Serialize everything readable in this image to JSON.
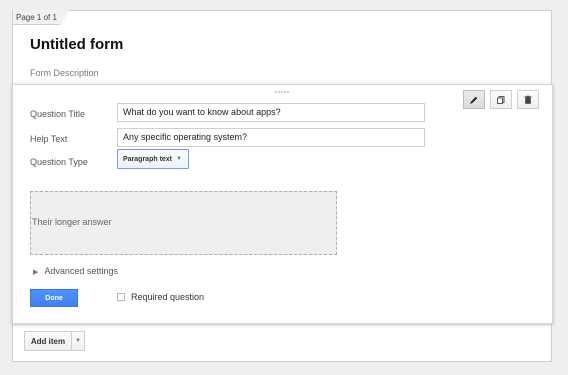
{
  "page_indicator": "Page 1 of 1",
  "form": {
    "title": "Untitled form",
    "description": "Form Description"
  },
  "editor": {
    "question_title_label": "Question Title",
    "question_title_value": "What do you want to know about apps?",
    "help_text_label": "Help Text",
    "help_text_value": "Any specific operating system?",
    "question_type_label": "Question Type",
    "question_type_value": "Paragraph text",
    "answer_placeholder": "Their longer answer",
    "advanced_settings": "Advanced settings",
    "done_label": "Done",
    "required_label": "Required question"
  },
  "toolbar": {
    "edit_icon": "pencil-icon",
    "duplicate_icon": "duplicate-icon",
    "delete_icon": "trash-icon"
  },
  "footer": {
    "add_item_label": "Add item"
  },
  "colors": {
    "page_background": "#efefef",
    "card_background": "#ffffff",
    "border": "#cfcfcf",
    "accent_blue": "#4a8cf7",
    "select_border": "#6f9cf7",
    "muted_text": "#7a7a7a"
  }
}
